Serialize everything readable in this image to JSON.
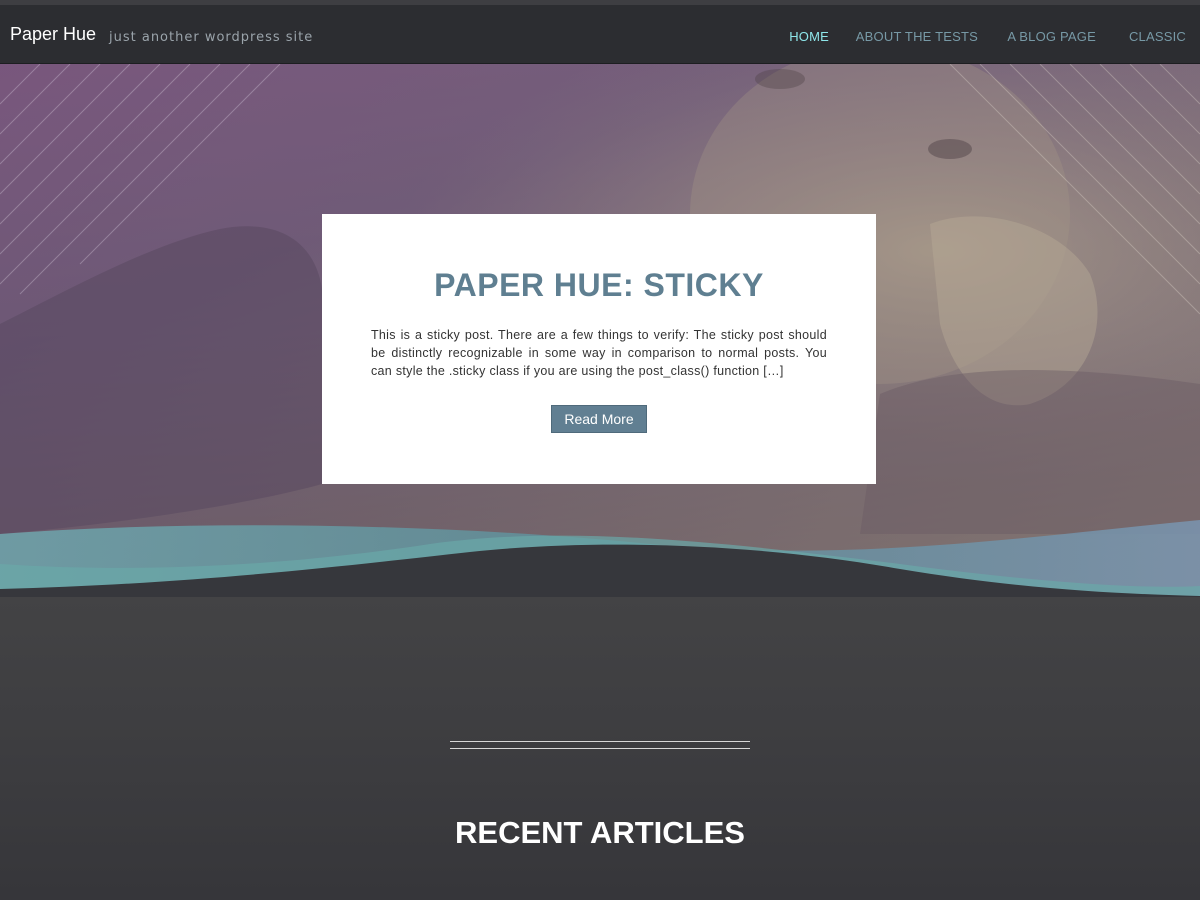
{
  "site": {
    "title": "Paper Hue",
    "tagline": "just another wordpress site"
  },
  "nav": {
    "items": [
      {
        "label": "HOME",
        "active": true
      },
      {
        "label": "ABOUT THE TESTS",
        "active": false
      },
      {
        "label": "A BLOG PAGE",
        "active": false
      },
      {
        "label": "CLASSIC",
        "active": false
      }
    ]
  },
  "featured": {
    "title": "PAPER HUE: STICKY",
    "excerpt": "This is a sticky post. There are a few things to verify: The sticky post should be distinctly recognizable in some way in comparison to normal posts. You can style the .sticky class if you are using the post_class() function […]",
    "button_label": "Read More"
  },
  "recent": {
    "title": "RECENT ARTICLES"
  },
  "colors": {
    "nav_bg": "#2c2d31",
    "nav_active": "#8ee6ea",
    "nav_link": "#7799a6",
    "accent": "#617f92",
    "title_color": "#5f7f91"
  }
}
